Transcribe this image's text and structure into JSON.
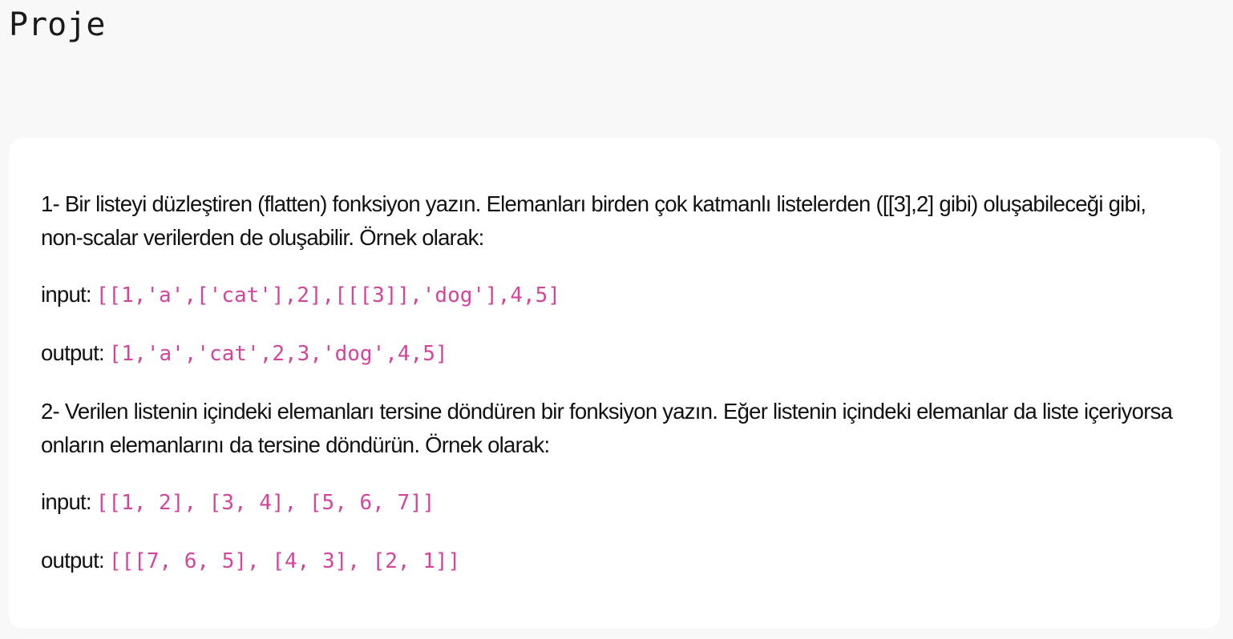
{
  "page": {
    "title": "Proje"
  },
  "tasks": [
    {
      "description": "1- Bir listeyi düzleştiren (flatten) fonksiyon yazın. Elemanları birden çok katmanlı listelerden ([[3],2] gibi) oluşabileceği gibi, non-scalar verilerden de oluşabilir. Örnek olarak:",
      "input_label": "input:",
      "input_code": "[[1,'a',['cat'],2],[[[3]],'dog'],4,5]",
      "output_label": "output:",
      "output_code": "[1,'a','cat',2,3,'dog',4,5]"
    },
    {
      "description": "2- Verilen listenin içindeki elemanları tersine döndüren bir fonksiyon yazın. Eğer listenin içindeki elemanlar da liste içeriyorsa onların elemanlarını da tersine döndürün. Örnek olarak:",
      "input_label": "input:",
      "input_code": "[[1, 2], [3, 4], [5, 6, 7]]",
      "output_label": "output:",
      "output_code": "[[[7, 6, 5], [4, 3], [2, 1]]"
    }
  ],
  "colors": {
    "code_text": "#d3459a",
    "page_background": "#f8f8f8",
    "card_background": "#ffffff"
  }
}
